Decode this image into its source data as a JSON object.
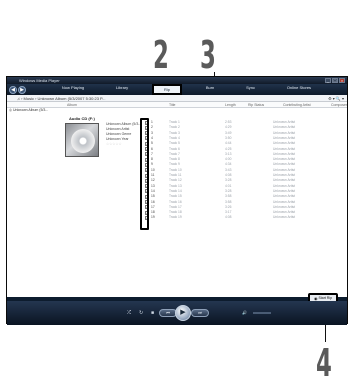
{
  "callouts": {
    "c2": "2",
    "c3": "3",
    "c4": "4"
  },
  "window": {
    "title": "Windows Media Player",
    "controls": {
      "minimize": "_",
      "maximize": "□",
      "close": "×"
    }
  },
  "nav": {
    "back": "◀",
    "forward": "▶",
    "tabs": [
      "Now Playing",
      "Library",
      "Rip",
      "Burn",
      "Sync",
      "Online Stores"
    ],
    "active_tab": 2
  },
  "address": {
    "path": "♫ › Music › Unknown Album (5/3/2007 5:30:23 P...",
    "right": "⚙ ▾  🔍 ▾"
  },
  "columns": [
    "Album",
    "Title",
    "Length",
    "Rip Status",
    "Contributing Artist",
    "Composer"
  ],
  "album": {
    "header": "Unknown Album (5/3...",
    "disc_label": "Audio CD (F:)",
    "info": [
      "Unknown Album (5/3...",
      "Unknown Artist",
      "Unknown Genre",
      "Unknown Year",
      "☆☆☆☆☆"
    ]
  },
  "tracks": [
    {
      "no": "1",
      "title": "Track 1",
      "length": "2:53",
      "artist": "Unknown Artist"
    },
    {
      "no": "2",
      "title": "Track 2",
      "length": "4:29",
      "artist": "Unknown Artist"
    },
    {
      "no": "3",
      "title": "Track 3",
      "length": "3:49",
      "artist": "Unknown Artist"
    },
    {
      "no": "4",
      "title": "Track 4",
      "length": "3:50",
      "artist": "Unknown Artist"
    },
    {
      "no": "5",
      "title": "Track 5",
      "length": "4:44",
      "artist": "Unknown Artist"
    },
    {
      "no": "6",
      "title": "Track 6",
      "length": "4:25",
      "artist": "Unknown Artist"
    },
    {
      "no": "7",
      "title": "Track 7",
      "length": "3:13",
      "artist": "Unknown Artist"
    },
    {
      "no": "8",
      "title": "Track 8",
      "length": "4:00",
      "artist": "Unknown Artist"
    },
    {
      "no": "9",
      "title": "Track 9",
      "length": "4:34",
      "artist": "Unknown Artist"
    },
    {
      "no": "10",
      "title": "Track 10",
      "length": "3:43",
      "artist": "Unknown Artist"
    },
    {
      "no": "11",
      "title": "Track 11",
      "length": "4:08",
      "artist": "Unknown Artist"
    },
    {
      "no": "12",
      "title": "Track 12",
      "length": "3:28",
      "artist": "Unknown Artist"
    },
    {
      "no": "13",
      "title": "Track 13",
      "length": "4:01",
      "artist": "Unknown Artist"
    },
    {
      "no": "14",
      "title": "Track 14",
      "length": "3:28",
      "artist": "Unknown Artist"
    },
    {
      "no": "15",
      "title": "Track 15",
      "length": "3:58",
      "artist": "Unknown Artist"
    },
    {
      "no": "16",
      "title": "Track 16",
      "length": "3:58",
      "artist": "Unknown Artist"
    },
    {
      "no": "17",
      "title": "Track 17",
      "length": "3:26",
      "artist": "Unknown Artist"
    },
    {
      "no": "18",
      "title": "Track 18",
      "length": "3:17",
      "artist": "Unknown Artist"
    },
    {
      "no": "19",
      "title": "Track 19",
      "length": "4:08",
      "artist": "Unknown Artist"
    }
  ],
  "rip_button": {
    "icon": "◉",
    "label": "Start Rip"
  },
  "player": {
    "shuffle": "⤮",
    "repeat": "↻",
    "stop": "■",
    "prev": "⏮",
    "play": "▶",
    "next": "⏭",
    "mute": "🔊"
  }
}
